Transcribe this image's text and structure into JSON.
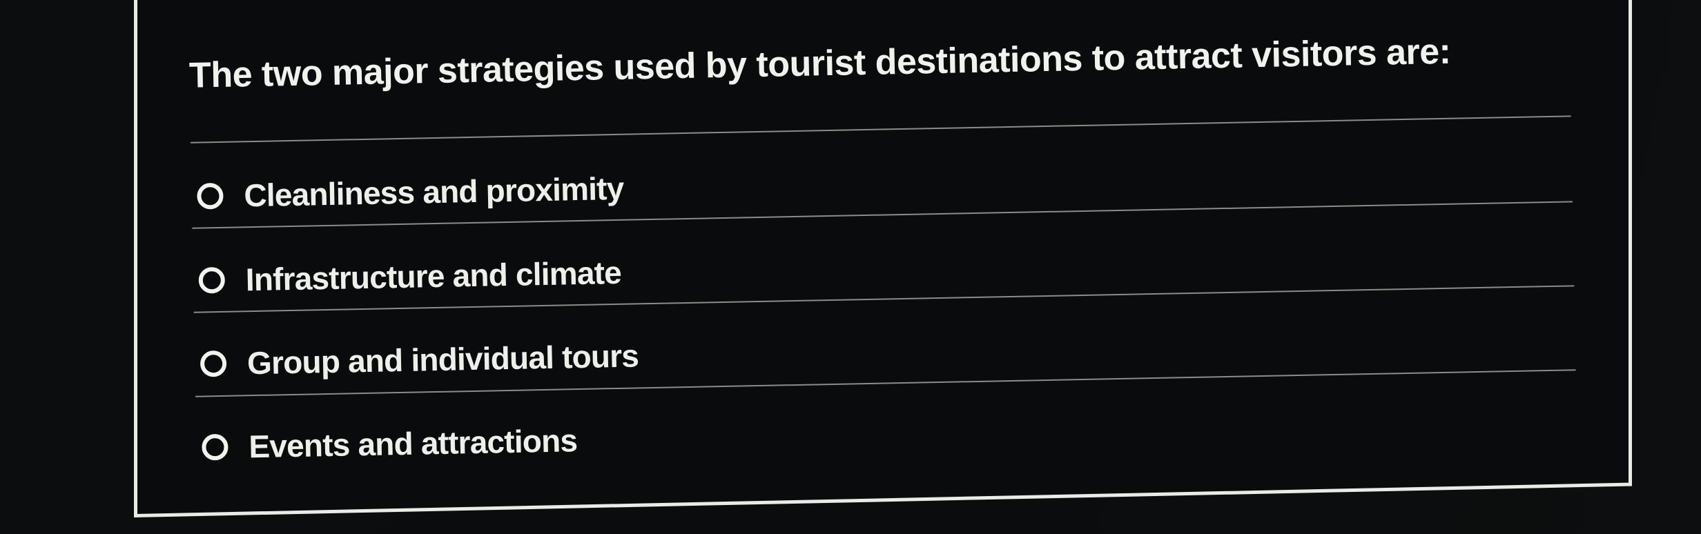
{
  "question": {
    "text": "The two major strategies used by tourist destinations to attract visitors are:"
  },
  "options": [
    {
      "label": "Cleanliness and proximity",
      "selected": false
    },
    {
      "label": "Infrastructure and climate",
      "selected": false
    },
    {
      "label": "Group and individual tours",
      "selected": false
    },
    {
      "label": "Events and attractions",
      "selected": false
    }
  ],
  "colors": {
    "background": "#0a0b0c",
    "text": "#f1f2ee",
    "divider": "#8a8d88",
    "panel_border": "#e9ebe6"
  }
}
